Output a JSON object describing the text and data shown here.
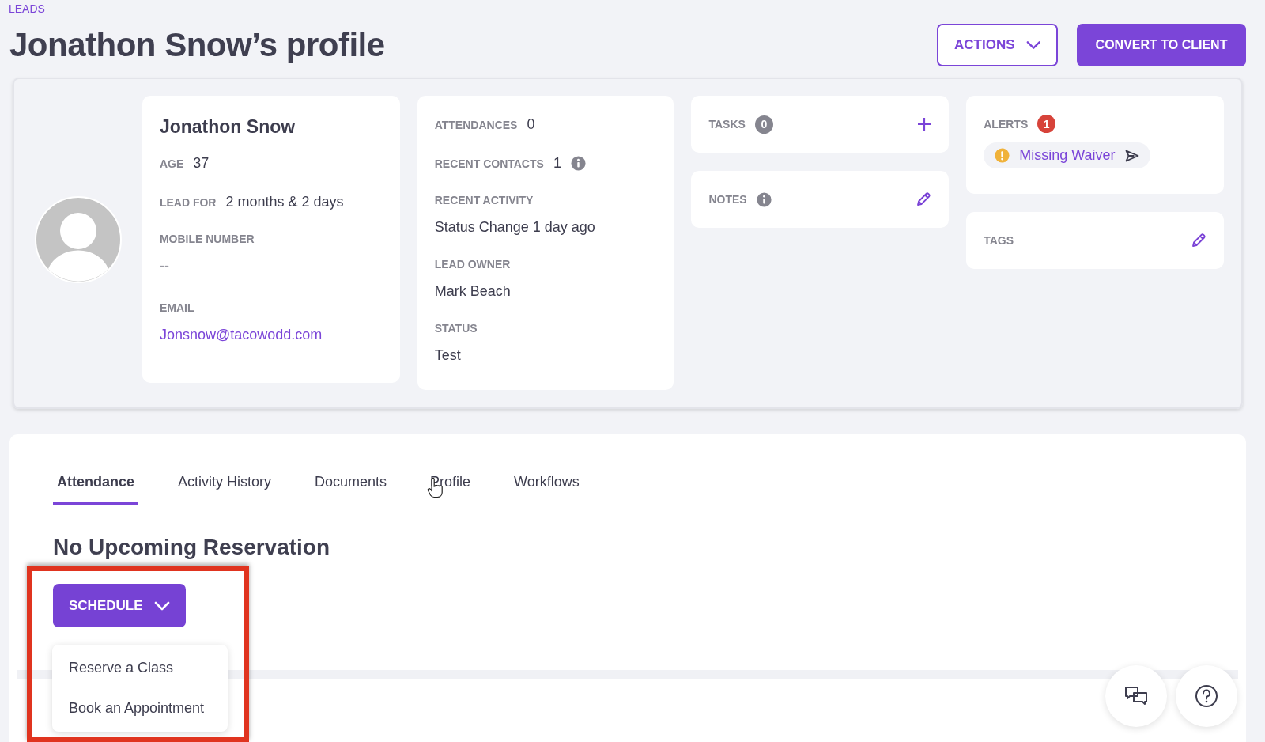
{
  "breadcrumb": "LEADS",
  "title": "Jonathon Snow’s profile",
  "header_buttons": [
    {
      "label": "ACTIONS",
      "kind": "outline"
    },
    {
      "label": "CONVERT TO CLIENT",
      "kind": "filled"
    }
  ],
  "contact": {
    "name": "Jonathon Snow",
    "fields": [
      {
        "label": "AGE",
        "value": "37",
        "kind": "inline"
      },
      {
        "label": "LEAD FOR",
        "value": "2 months & 2 days",
        "kind": "inline"
      },
      {
        "label": "MOBILE NUMBER",
        "value": "--",
        "kind": "empty"
      },
      {
        "label": "EMAIL",
        "value": "Jonsnow@tacowodd.com",
        "kind": "link"
      }
    ]
  },
  "stats": [
    {
      "label": "ATTENDANCES",
      "value": "0",
      "kind": "inline"
    },
    {
      "label": "RECENT CONTACTS",
      "value": "1",
      "kind": "inline-info"
    },
    {
      "label": "RECENT ACTIVITY",
      "value": "Status Change 1 day ago",
      "kind": "stacked"
    },
    {
      "label": "LEAD OWNER",
      "value": "Mark Beach",
      "kind": "stacked"
    },
    {
      "label": "STATUS",
      "value": "Test",
      "kind": "stacked"
    }
  ],
  "tasks": {
    "label": "TASKS",
    "count": "0"
  },
  "notes": {
    "label": "NOTES"
  },
  "alerts": {
    "label": "ALERTS",
    "count": "1",
    "items": [
      "Missing Waiver"
    ]
  },
  "tags": {
    "label": "TAGS"
  },
  "tabs": [
    {
      "label": "Attendance",
      "selected": true
    },
    {
      "label": "Activity History",
      "selected": false
    },
    {
      "label": "Documents",
      "selected": false
    },
    {
      "label": "Profile",
      "selected": false
    },
    {
      "label": "Workflows",
      "selected": false
    }
  ],
  "reservation_heading": "No Upcoming Reservation",
  "schedule": {
    "label": "SCHEDULE",
    "expanded": true,
    "menu": [
      "Reserve a Class",
      "Book an Appointment"
    ]
  }
}
